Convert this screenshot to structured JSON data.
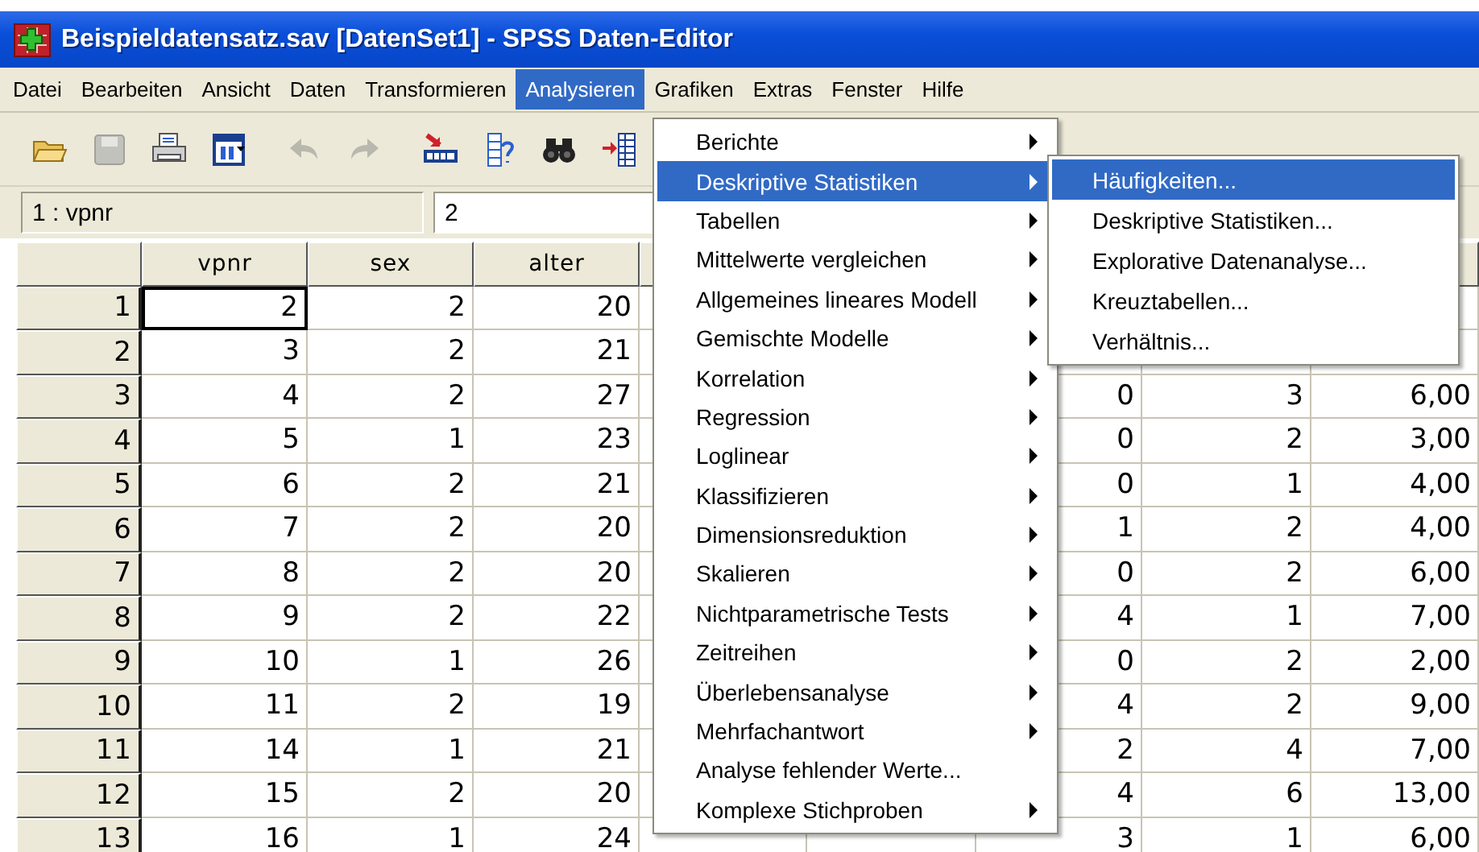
{
  "window": {
    "title": "Beispieldatensatz.sav [DatenSet1] - SPSS Daten-Editor"
  },
  "menu_bar": [
    {
      "label": "Datei",
      "selected": false
    },
    {
      "label": "Bearbeiten",
      "selected": false
    },
    {
      "label": "Ansicht",
      "selected": false
    },
    {
      "label": "Daten",
      "selected": false
    },
    {
      "label": "Transformieren",
      "selected": false
    },
    {
      "label": "Analysieren",
      "selected": true
    },
    {
      "label": "Grafiken",
      "selected": false
    },
    {
      "label": "Extras",
      "selected": false
    },
    {
      "label": "Fenster",
      "selected": false
    },
    {
      "label": "Hilfe",
      "selected": false
    }
  ],
  "toolbar": [
    {
      "kind": "open",
      "disabled": false
    },
    {
      "kind": "save",
      "disabled": true
    },
    {
      "kind": "print",
      "disabled": false
    },
    {
      "kind": "dialog",
      "disabled": false
    },
    {
      "kind": "undo",
      "disabled": true
    },
    {
      "kind": "redo",
      "disabled": true
    },
    {
      "kind": "goto",
      "disabled": false
    },
    {
      "kind": "variables",
      "disabled": false
    },
    {
      "kind": "find",
      "disabled": false
    },
    {
      "kind": "insert",
      "disabled": false
    }
  ],
  "cell_bar": {
    "cell_ref": "1 : vpnr",
    "value": "2"
  },
  "table": {
    "columns": [
      "vpnr",
      "sex",
      "alter"
    ],
    "rows": [
      {
        "label": "1",
        "cells": [
          {
            "value": "2",
            "selected": true
          },
          {
            "value": "2",
            "selected": false
          },
          {
            "value": "20",
            "selected": false
          },
          null,
          null,
          null,
          null,
          null
        ]
      },
      {
        "label": "2",
        "cells": [
          {
            "value": "3",
            "selected": false
          },
          {
            "value": "2",
            "selected": false
          },
          {
            "value": "21",
            "selected": false
          },
          null,
          null,
          null,
          null,
          null
        ]
      },
      {
        "label": "3",
        "cells": [
          {
            "value": "4",
            "selected": false
          },
          {
            "value": "2",
            "selected": false
          },
          {
            "value": "27",
            "selected": false
          },
          null,
          null,
          {
            "value": "0",
            "selected": false
          },
          {
            "value": "3",
            "selected": false
          },
          {
            "value": "6,00",
            "selected": false
          }
        ]
      },
      {
        "label": "4",
        "cells": [
          {
            "value": "5",
            "selected": false
          },
          {
            "value": "1",
            "selected": false
          },
          {
            "value": "23",
            "selected": false
          },
          null,
          null,
          {
            "value": "0",
            "selected": false
          },
          {
            "value": "2",
            "selected": false
          },
          {
            "value": "3,00",
            "selected": false
          }
        ]
      },
      {
        "label": "5",
        "cells": [
          {
            "value": "6",
            "selected": false
          },
          {
            "value": "2",
            "selected": false
          },
          {
            "value": "21",
            "selected": false
          },
          null,
          null,
          {
            "value": "0",
            "selected": false
          },
          {
            "value": "1",
            "selected": false
          },
          {
            "value": "4,00",
            "selected": false
          }
        ]
      },
      {
        "label": "6",
        "cells": [
          {
            "value": "7",
            "selected": false
          },
          {
            "value": "2",
            "selected": false
          },
          {
            "value": "20",
            "selected": false
          },
          null,
          null,
          {
            "value": "1",
            "selected": false
          },
          {
            "value": "2",
            "selected": false
          },
          {
            "value": "4,00",
            "selected": false
          }
        ]
      },
      {
        "label": "7",
        "cells": [
          {
            "value": "8",
            "selected": false
          },
          {
            "value": "2",
            "selected": false
          },
          {
            "value": "20",
            "selected": false
          },
          null,
          null,
          {
            "value": "0",
            "selected": false
          },
          {
            "value": "2",
            "selected": false
          },
          {
            "value": "6,00",
            "selected": false
          }
        ]
      },
      {
        "label": "8",
        "cells": [
          {
            "value": "9",
            "selected": false
          },
          {
            "value": "2",
            "selected": false
          },
          {
            "value": "22",
            "selected": false
          },
          null,
          null,
          {
            "value": "4",
            "selected": false
          },
          {
            "value": "1",
            "selected": false
          },
          {
            "value": "7,00",
            "selected": false
          }
        ]
      },
      {
        "label": "9",
        "cells": [
          {
            "value": "10",
            "selected": false
          },
          {
            "value": "1",
            "selected": false
          },
          {
            "value": "26",
            "selected": false
          },
          null,
          null,
          {
            "value": "0",
            "selected": false
          },
          {
            "value": "2",
            "selected": false
          },
          {
            "value": "2,00",
            "selected": false
          }
        ]
      },
      {
        "label": "10",
        "cells": [
          {
            "value": "11",
            "selected": false
          },
          {
            "value": "2",
            "selected": false
          },
          {
            "value": "19",
            "selected": false
          },
          null,
          null,
          {
            "value": "4",
            "selected": false
          },
          {
            "value": "2",
            "selected": false
          },
          {
            "value": "9,00",
            "selected": false
          }
        ]
      },
      {
        "label": "11",
        "cells": [
          {
            "value": "14",
            "selected": false
          },
          {
            "value": "1",
            "selected": false
          },
          {
            "value": "21",
            "selected": false
          },
          null,
          null,
          {
            "value": "2",
            "selected": false
          },
          {
            "value": "4",
            "selected": false
          },
          {
            "value": "7,00",
            "selected": false
          }
        ]
      },
      {
        "label": "12",
        "cells": [
          {
            "value": "15",
            "selected": false
          },
          {
            "value": "2",
            "selected": false
          },
          {
            "value": "20",
            "selected": false
          },
          null,
          null,
          {
            "value": "4",
            "selected": false
          },
          {
            "value": "6",
            "selected": false
          },
          {
            "value": "13,00",
            "selected": false
          }
        ]
      },
      {
        "label": "13",
        "cells": [
          {
            "value": "16",
            "selected": false
          },
          {
            "value": "1",
            "selected": false
          },
          {
            "value": "24",
            "selected": false
          },
          null,
          null,
          {
            "value": "3",
            "selected": false
          },
          {
            "value": "1",
            "selected": false
          },
          {
            "value": "6,00",
            "selected": false
          }
        ]
      }
    ]
  },
  "analysis_menu": {
    "items": [
      {
        "label": "Berichte",
        "submenu": true,
        "selected": false
      },
      {
        "label": "Deskriptive Statistiken",
        "submenu": true,
        "selected": true
      },
      {
        "label": "Tabellen",
        "submenu": true,
        "selected": false
      },
      {
        "label": "Mittelwerte vergleichen",
        "submenu": true,
        "selected": false
      },
      {
        "label": "Allgemeines lineares Modell",
        "submenu": true,
        "selected": false
      },
      {
        "label": "Gemischte Modelle",
        "submenu": true,
        "selected": false
      },
      {
        "label": "Korrelation",
        "submenu": true,
        "selected": false
      },
      {
        "label": "Regression",
        "submenu": true,
        "selected": false
      },
      {
        "label": "Loglinear",
        "submenu": true,
        "selected": false
      },
      {
        "label": "Klassifizieren",
        "submenu": true,
        "selected": false
      },
      {
        "label": "Dimensionsreduktion",
        "submenu": true,
        "selected": false
      },
      {
        "label": "Skalieren",
        "submenu": true,
        "selected": false
      },
      {
        "label": "Nichtparametrische Tests",
        "submenu": true,
        "selected": false
      },
      {
        "label": "Zeitreihen",
        "submenu": true,
        "selected": false
      },
      {
        "label": "Überlebensanalyse",
        "submenu": true,
        "selected": false
      },
      {
        "label": "Mehrfachantwort",
        "submenu": true,
        "selected": false
      },
      {
        "label": "Analyse fehlender Werte...",
        "submenu": false,
        "selected": false
      },
      {
        "label": "Komplexe Stichproben",
        "submenu": true,
        "selected": false
      }
    ]
  },
  "descriptive_submenu": {
    "items": [
      {
        "label": "Häufigkeiten...",
        "selected": true
      },
      {
        "label": "Deskriptive Statistiken...",
        "selected": false
      },
      {
        "label": "Explorative Datenanalyse...",
        "selected": false
      },
      {
        "label": "Kreuztabellen...",
        "selected": false
      },
      {
        "label": "Verhältnis...",
        "selected": false
      }
    ]
  }
}
